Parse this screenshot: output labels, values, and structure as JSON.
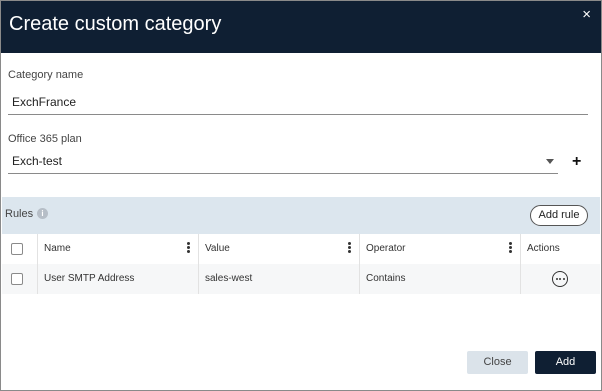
{
  "dialog": {
    "title": "Create custom category",
    "close_glyph": "×"
  },
  "category_name": {
    "label": "Category name",
    "value": "ExchFrance"
  },
  "plan": {
    "label": "Office 365 plan",
    "selected": "Exch-test",
    "add_glyph": "+"
  },
  "rules": {
    "label": "Rules",
    "info_glyph": "i",
    "add_rule_label": "Add rule",
    "columns": {
      "name": "Name",
      "value": "Value",
      "operator": "Operator",
      "actions": "Actions"
    },
    "rows": [
      {
        "name": "User SMTP Address",
        "value": "sales-west",
        "operator": "Contains"
      }
    ]
  },
  "footer": {
    "close_label": "Close",
    "add_label": "Add"
  },
  "colors": {
    "header_bg": "#0f1f33",
    "rules_bar_bg": "#dce6ee",
    "primary_button": "#0f1f33",
    "secondary_button": "#dbe3ea"
  },
  "icons": {
    "close": "close-icon",
    "dropdown": "chevron-down-icon",
    "add_plan": "plus-icon",
    "info": "info-icon",
    "column_menu": "kebab-menu-icon",
    "row_actions": "more-horizontal-icon"
  }
}
